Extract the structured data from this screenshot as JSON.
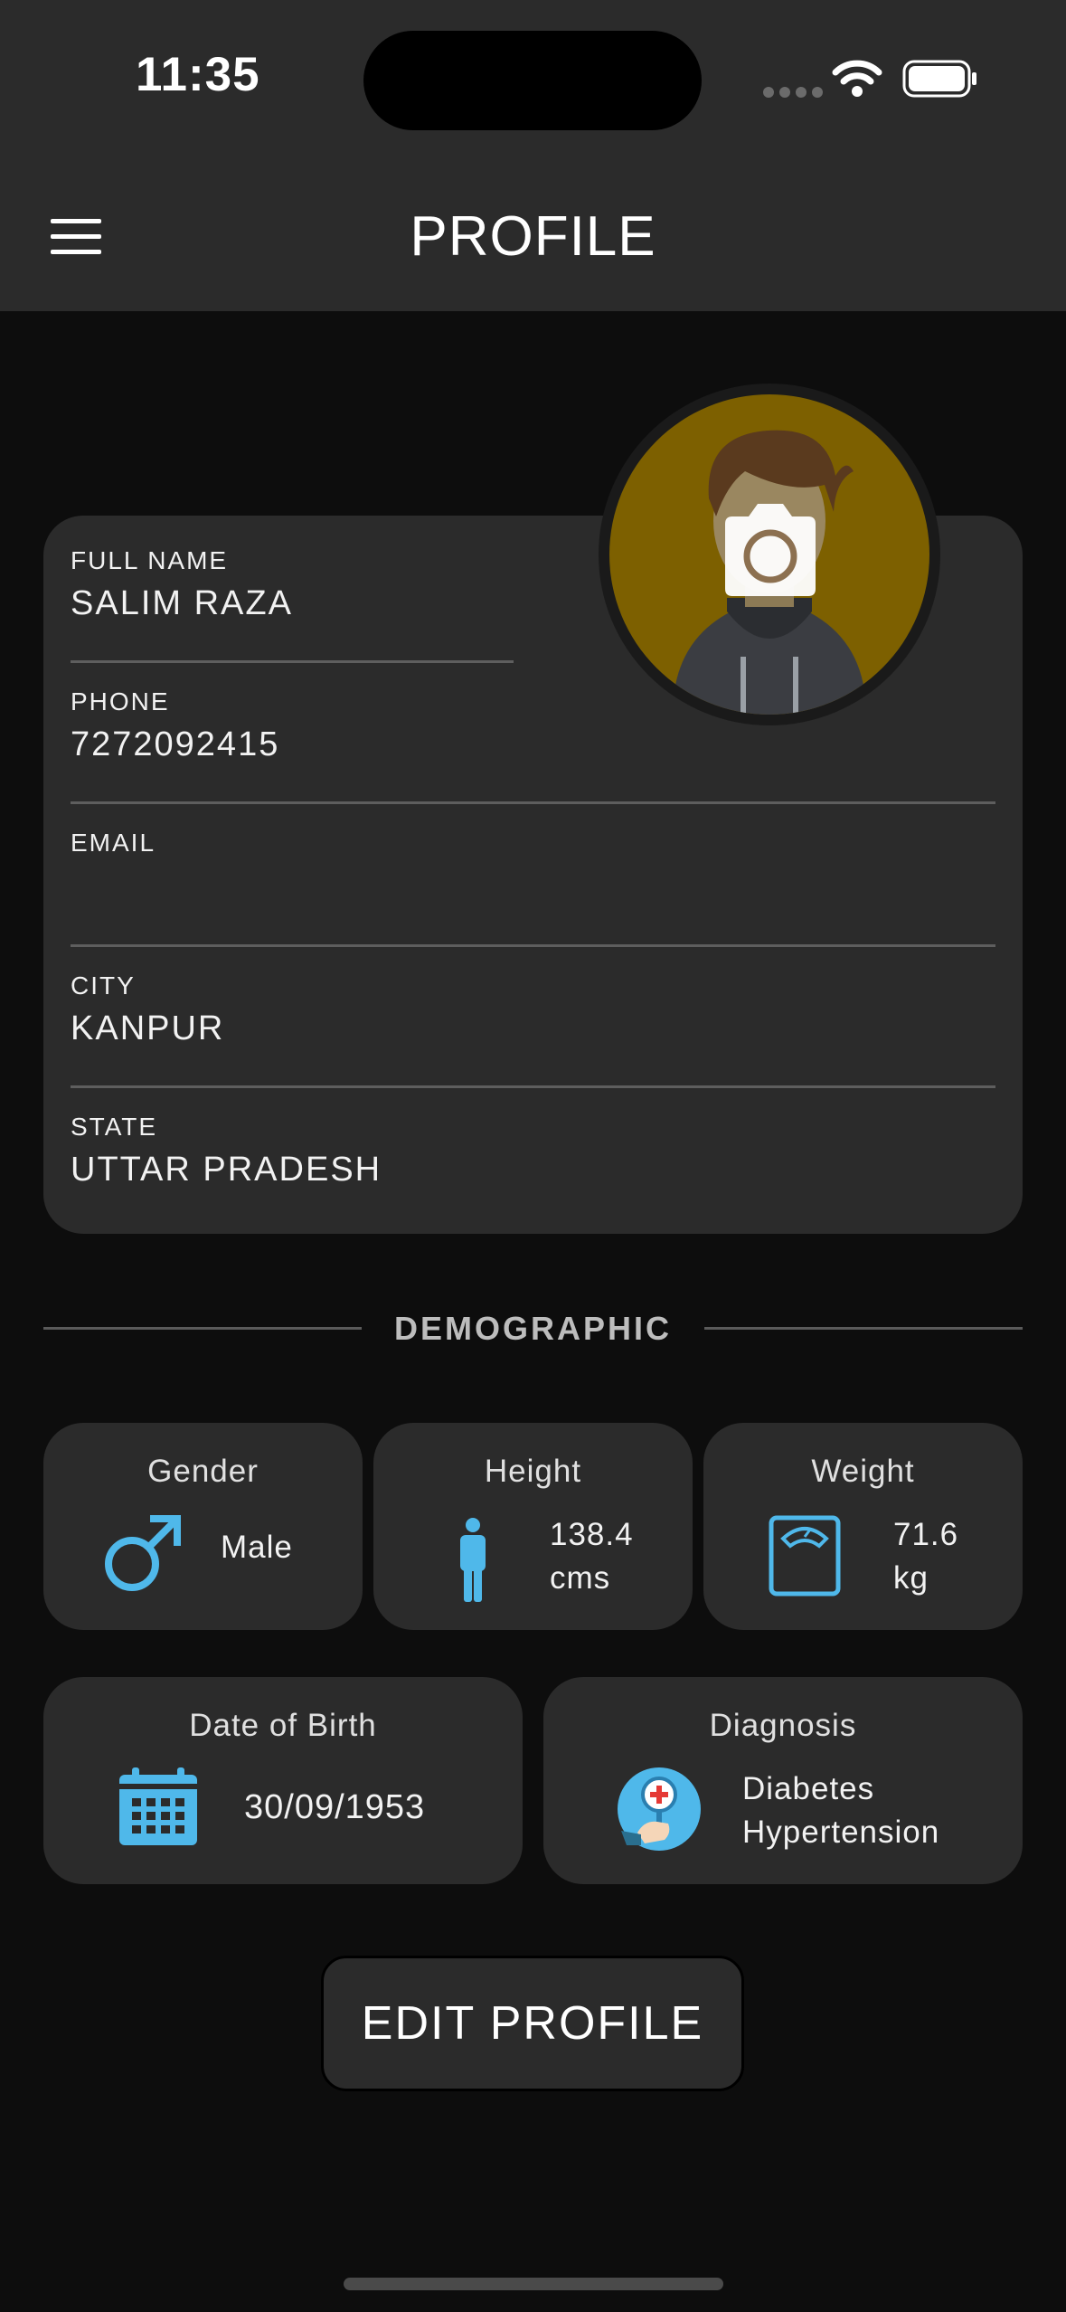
{
  "status_bar": {
    "time": "11:35"
  },
  "header": {
    "title": "PROFILE"
  },
  "profile": {
    "fields": [
      {
        "label": "FULL NAME",
        "value": "SALIM RAZA"
      },
      {
        "label": "PHONE",
        "value": "7272092415"
      },
      {
        "label": "EMAIL",
        "value": ""
      },
      {
        "label": "CITY",
        "value": "KANPUR"
      },
      {
        "label": "STATE",
        "value": "UTTAR PRADESH"
      }
    ]
  },
  "demographic": {
    "title": "DEMOGRAPHIC",
    "gender": {
      "title": "Gender",
      "value": "Male"
    },
    "height": {
      "title": "Height",
      "value_line1": "138.4",
      "value_line2": "cms"
    },
    "weight": {
      "title": "Weight",
      "value_line1": "71.6",
      "value_line2": "kg"
    },
    "dob": {
      "title": "Date of Birth",
      "value": "30/09/1953"
    },
    "diagnosis": {
      "title": "Diagnosis",
      "items": [
        "Diabetes",
        "Hypertension"
      ]
    }
  },
  "actions": {
    "edit_label": "EDIT PROFILE"
  },
  "colors": {
    "accent": "#4fb8ea",
    "card": "#2b2b2b",
    "background": "#0d0d0d",
    "avatar_bg": "#7d6000"
  }
}
